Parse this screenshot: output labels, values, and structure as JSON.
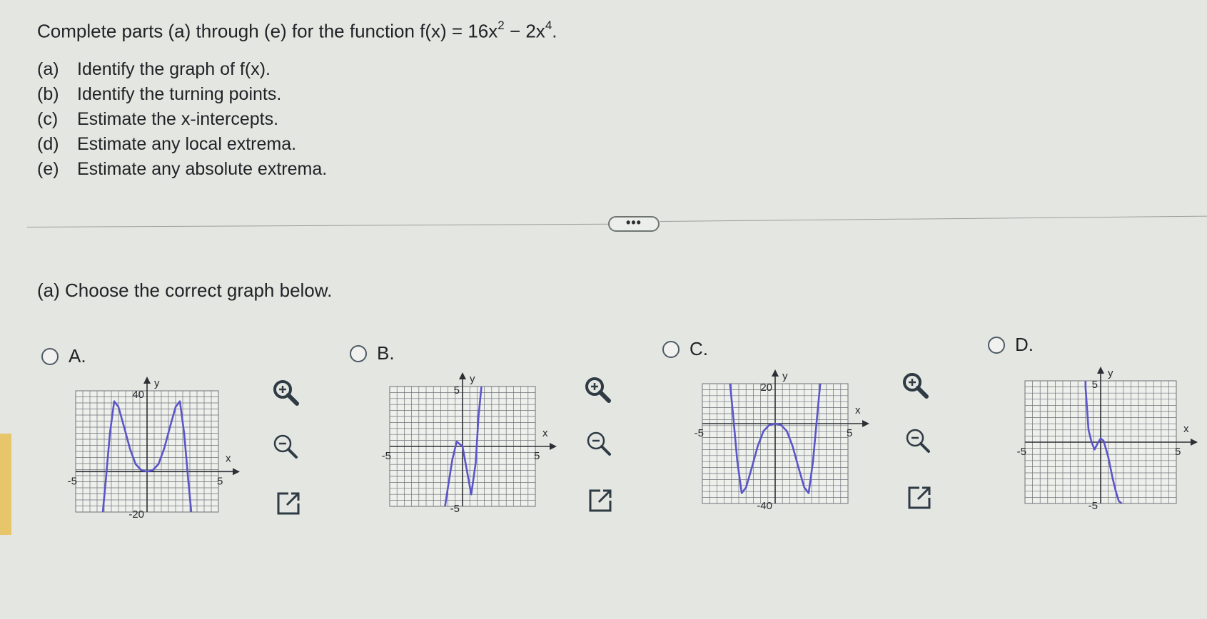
{
  "question": {
    "intro": "Complete parts (a) through (e) for the function f(x) = 16x",
    "exp1": "2",
    "mid": " − 2x",
    "exp2": "4",
    "end": ".",
    "parts": [
      {
        "label": "(a)",
        "text": "Identify the graph of f(x)."
      },
      {
        "label": "(b)",
        "text": "Identify the turning points."
      },
      {
        "label": "(c)",
        "text": "Estimate the x-intercepts."
      },
      {
        "label": "(d)",
        "text": "Estimate any local extrema."
      },
      {
        "label": "(e)",
        "text": "Estimate any absolute extrema."
      }
    ]
  },
  "more_button": "•••",
  "part_a_prompt": "(a) Choose the correct graph below.",
  "options": [
    {
      "letter": "A.",
      "x_label": "x",
      "y_label": "y",
      "ticks": {
        "ymax": "40",
        "ymin": "-20",
        "xmin": "-5",
        "xmax": "5"
      }
    },
    {
      "letter": "B.",
      "x_label": "x",
      "y_label": "y",
      "ticks": {
        "ymax": "5",
        "ymin": "-5",
        "xmin": "-5",
        "xmax": "5"
      }
    },
    {
      "letter": "C.",
      "x_label": "x",
      "y_label": "y",
      "ticks": {
        "ymax": "20",
        "ymin": "-40",
        "xmin": "-5",
        "xmax": "5"
      }
    },
    {
      "letter": "D.",
      "x_label": "x",
      "y_label": "y",
      "ticks": {
        "ymax": "5",
        "ymin": "-5",
        "xmin": "-5",
        "xmax": "5"
      }
    }
  ],
  "chart_data": [
    {
      "type": "line",
      "option": "A",
      "title": "",
      "xlabel": "x",
      "ylabel": "y",
      "xlim": [
        -5,
        5
      ],
      "ylim": [
        -20,
        40
      ],
      "grid": true,
      "series": [
        {
          "x": [
            -3.1,
            -2.9,
            -2.6,
            -2.3,
            -2.0,
            -1.6,
            -1.2,
            -0.8,
            -0.4,
            0.0,
            0.4,
            0.8,
            1.2,
            1.6,
            2.0,
            2.3,
            2.6,
            2.9,
            3.1
          ],
          "y": [
            -20,
            -5.3,
            19.0,
            34.8,
            32.0,
            21.9,
            11.4,
            3.7,
            0.7,
            0.0,
            0.7,
            3.7,
            11.4,
            21.9,
            32.0,
            34.8,
            19.0,
            -5.3,
            -20
          ]
        }
      ]
    },
    {
      "type": "line",
      "option": "B",
      "title": "",
      "xlabel": "x",
      "ylabel": "y",
      "xlim": [
        -5,
        5
      ],
      "ylim": [
        -5,
        5
      ],
      "grid": true,
      "series": [
        {
          "x": [
            -1.2,
            -1.0,
            -0.7,
            -0.4,
            0.0,
            0.3,
            0.6,
            0.9,
            1.1,
            1.3
          ],
          "y": [
            -5,
            -3.4,
            -1.1,
            0.4,
            0.0,
            -2.0,
            -4.0,
            -1.4,
            2.5,
            5
          ]
        }
      ]
    },
    {
      "type": "line",
      "option": "C",
      "title": "",
      "xlabel": "x",
      "ylabel": "y",
      "xlim": [
        -5,
        5
      ],
      "ylim": [
        -40,
        20
      ],
      "grid": true,
      "series": [
        {
          "x": [
            -3.1,
            -2.9,
            -2.6,
            -2.3,
            -2.0,
            -1.6,
            -1.2,
            -0.8,
            -0.4,
            0.0,
            0.4,
            0.8,
            1.2,
            1.6,
            2.0,
            2.3,
            2.6,
            2.9,
            3.1
          ],
          "y": [
            20,
            5.3,
            -19.0,
            -34.8,
            -32.0,
            -21.9,
            -11.4,
            -3.7,
            -0.7,
            0.0,
            -0.7,
            -3.7,
            -11.4,
            -21.9,
            -32.0,
            -34.8,
            -19.0,
            5.3,
            20
          ]
        }
      ]
    },
    {
      "type": "line",
      "option": "D",
      "title": "",
      "xlabel": "x",
      "ylabel": "y",
      "xlim": [
        -5,
        5
      ],
      "ylim": [
        -5,
        5
      ],
      "grid": true,
      "series": [
        {
          "x": [
            -1.0,
            -1.0,
            -0.9,
            -0.8,
            -0.6,
            -0.4,
            -0.2,
            0.0,
            0.2,
            0.5,
            0.8,
            1.0,
            1.2,
            1.4
          ],
          "y": [
            5,
            4.5,
            2.8,
            1.0,
            0.0,
            -0.6,
            -0.1,
            0.3,
            0.1,
            -1.2,
            -3.0,
            -4.0,
            -4.8,
            -5
          ]
        }
      ]
    }
  ],
  "colors": {
    "curve": "#5b55c9",
    "grid": "#6c7277",
    "axis": "#2c3035",
    "background": "#e4e6e1"
  },
  "icons": [
    "zoom-in-icon",
    "zoom-out-icon",
    "external-link-icon"
  ]
}
